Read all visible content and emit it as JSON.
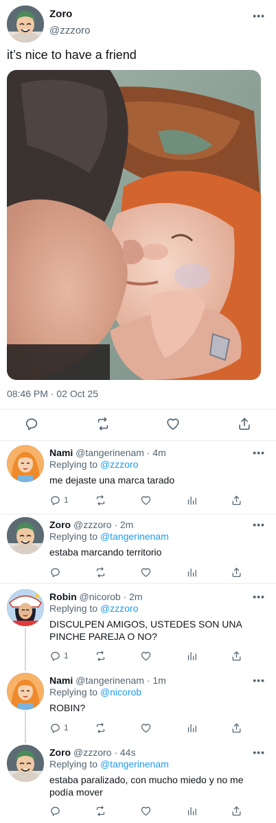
{
  "colors": {
    "accent": "#1d9bf0",
    "muted": "#536471",
    "text": "#0f1419",
    "divider": "#e6ecf0"
  },
  "main": {
    "author_name": "Zoro",
    "author_handle": "@zzzoro",
    "text": "it’s nice to have a friend",
    "timestamp": "08:46 PM · 02 Oct 25",
    "actions": [
      "reply-icon",
      "retweet-icon",
      "like-icon",
      "share-icon"
    ]
  },
  "replies": [
    {
      "name": "Nami",
      "handle": "@tangerinenam",
      "time": "· 4m",
      "replying_prefix": "Replying to ",
      "replying_to": "@zzzoro",
      "text": "me dejaste una marca tarado",
      "reply_count": "1"
    },
    {
      "name": "Zoro",
      "handle": "@zzzoro",
      "time": "· 2m",
      "replying_prefix": "Replying to ",
      "replying_to": "@tangerinenam",
      "text": "estaba marcando territorio",
      "reply_count": ""
    },
    {
      "name": "Robin",
      "handle": "@nicorob",
      "time": "· 2m",
      "replying_prefix": "Replying to ",
      "replying_to": "@zzzoro",
      "text": "DISCULPEN AMIGOS, USTEDES SON UNA PINCHE PAREJA O NO?",
      "reply_count": "1"
    },
    {
      "name": "Nami",
      "handle": "@tangerinenam",
      "time": "· 1m",
      "replying_prefix": "Replying to ",
      "replying_to": "@nicorob",
      "text": "ROBIN?",
      "reply_count": "1"
    },
    {
      "name": "Zoro",
      "handle": "@zzzoro",
      "time": "· 44s",
      "replying_prefix": "Replying to ",
      "replying_to": "@tangerinenam",
      "text": "estaba paralizado, con mucho miedo y no me podía mover",
      "reply_count": ""
    }
  ]
}
